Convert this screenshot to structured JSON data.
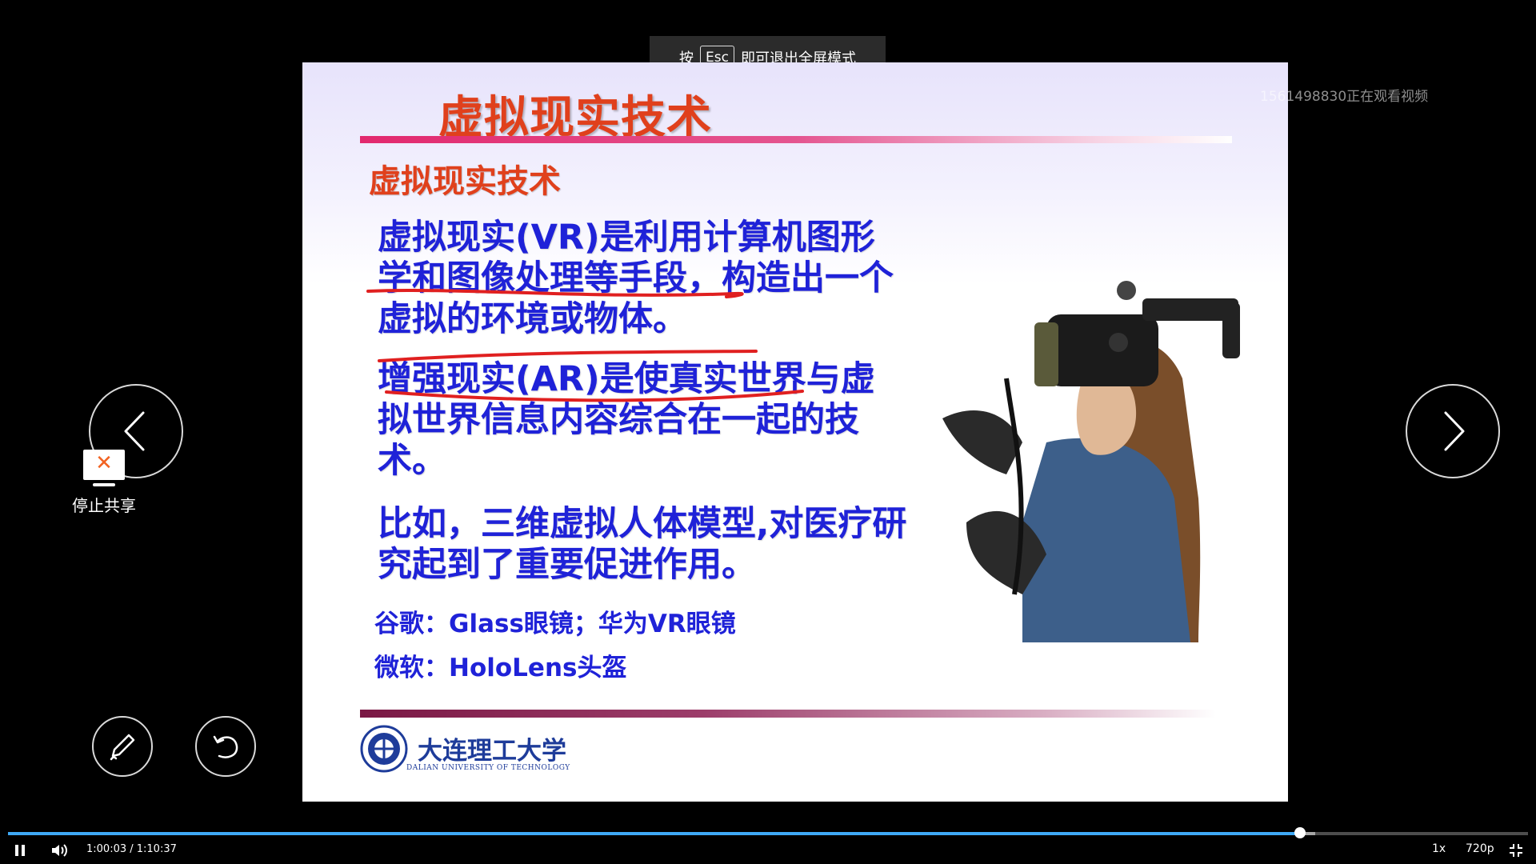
{
  "fullscreen_hint": {
    "prefix": "按",
    "key": "Esc",
    "suffix": "即可退出全屏模式"
  },
  "viewer_watermark": "1561498830正在观看视频",
  "slide": {
    "title": "虚拟现实技术",
    "subtitle": "虚拟现实技术",
    "paragraph_1": "虚拟现实(VR)是利用计算机图形学和图像处理等手段，构造出一个虚拟的环境或物体。",
    "paragraph_2": "增强现实(AR)是使真实世界与虚拟世界信息内容综合在一起的技术。",
    "paragraph_3": "比如，三维虚拟人体模型,对医疗研究起到了重要促进作用。",
    "google_line": "谷歌：Glass眼镜；华为VR眼镜",
    "microsoft_line": "微软：HoloLens头盔",
    "logo_cn": "大连理工大学",
    "logo_en": "DALIAN UNIVERSITY OF TECHNOLOGY"
  },
  "controls": {
    "stop_share_label": "停止共享",
    "stop_share_icon": "close-icon",
    "prev_icon": "chevron-left-icon",
    "next_icon": "chevron-right-icon",
    "pen_icon": "pen-icon",
    "undo_icon": "undo-icon"
  },
  "player": {
    "current_time": "1:00:03",
    "total_time": "1:10:37",
    "time_display": "1:00:03 / 1:10:37",
    "progress_fraction": 0.85,
    "buffered_fraction": 0.86,
    "speed": "1x",
    "quality": "720p",
    "accent_color": "#3fa9f5"
  }
}
